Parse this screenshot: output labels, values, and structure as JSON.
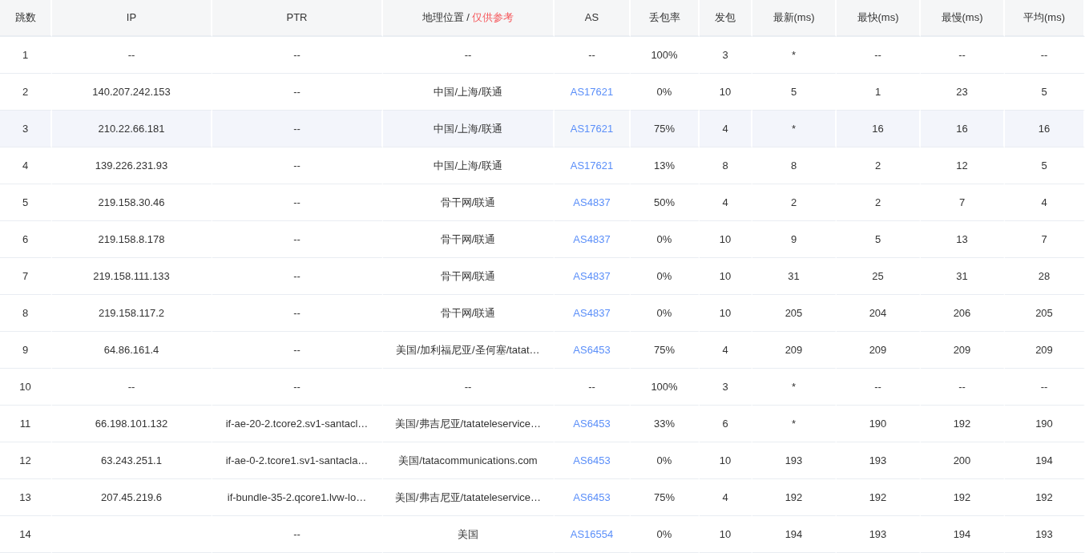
{
  "table": {
    "columns": [
      {
        "label": "跳数"
      },
      {
        "label": "IP"
      },
      {
        "label": "PTR"
      },
      {
        "label": "地理位置 /",
        "note": "仅供参考"
      },
      {
        "label": "AS"
      },
      {
        "label": "丢包率"
      },
      {
        "label": "发包"
      },
      {
        "label": "最新(ms)"
      },
      {
        "label": "最快(ms)"
      },
      {
        "label": "最慢(ms)"
      },
      {
        "label": "平均(ms)"
      }
    ],
    "rows": [
      {
        "highlighted": false,
        "hop": "1",
        "ip": "--",
        "ptr": "--",
        "geo": "--",
        "as": {
          "kind": "plain",
          "text": "--"
        },
        "loss": "100%",
        "sent": "3",
        "last": "*",
        "best": "--",
        "worst": "--",
        "avg": "--"
      },
      {
        "highlighted": false,
        "hop": "2",
        "ip": "140.207.242.153",
        "ptr": "--",
        "geo": "中国/上海/联通",
        "as": {
          "kind": "link",
          "text": "AS17621"
        },
        "loss": "0%",
        "sent": "10",
        "last": "5",
        "best": "1",
        "worst": "23",
        "avg": "5"
      },
      {
        "highlighted": true,
        "hop": "3",
        "ip": "210.22.66.181",
        "ptr": "--",
        "geo": "中国/上海/联通",
        "as": {
          "kind": "link",
          "text": "AS17621"
        },
        "loss": "75%",
        "sent": "4",
        "last": "*",
        "best": "16",
        "worst": "16",
        "avg": "16"
      },
      {
        "highlighted": false,
        "hop": "4",
        "ip": "139.226.231.93",
        "ptr": "--",
        "geo": "中国/上海/联通",
        "as": {
          "kind": "link",
          "text": "AS17621"
        },
        "loss": "13%",
        "sent": "8",
        "last": "8",
        "best": "2",
        "worst": "12",
        "avg": "5"
      },
      {
        "highlighted": false,
        "hop": "5",
        "ip": "219.158.30.46",
        "ptr": "--",
        "geo": "骨干网/联通",
        "as": {
          "kind": "link",
          "text": "AS4837"
        },
        "loss": "50%",
        "sent": "4",
        "last": "2",
        "best": "2",
        "worst": "7",
        "avg": "4"
      },
      {
        "highlighted": false,
        "hop": "6",
        "ip": "219.158.8.178",
        "ptr": "--",
        "geo": "骨干网/联通",
        "as": {
          "kind": "link",
          "text": "AS4837"
        },
        "loss": "0%",
        "sent": "10",
        "last": "9",
        "best": "5",
        "worst": "13",
        "avg": "7"
      },
      {
        "highlighted": false,
        "hop": "7",
        "ip": "219.158.111.133",
        "ptr": "--",
        "geo": "骨干网/联通",
        "as": {
          "kind": "link",
          "text": "AS4837"
        },
        "loss": "0%",
        "sent": "10",
        "last": "31",
        "best": "25",
        "worst": "31",
        "avg": "28"
      },
      {
        "highlighted": false,
        "hop": "8",
        "ip": "219.158.117.2",
        "ptr": "--",
        "geo": "骨干网/联通",
        "as": {
          "kind": "link",
          "text": "AS4837"
        },
        "loss": "0%",
        "sent": "10",
        "last": "205",
        "best": "204",
        "worst": "206",
        "avg": "205"
      },
      {
        "highlighted": false,
        "hop": "9",
        "ip": "64.86.161.4",
        "ptr": "--",
        "geo": "美国/加利福尼亚/圣何塞/tatat…",
        "as": {
          "kind": "link",
          "text": "AS6453"
        },
        "loss": "75%",
        "sent": "4",
        "last": "209",
        "best": "209",
        "worst": "209",
        "avg": "209"
      },
      {
        "highlighted": false,
        "hop": "10",
        "ip": "--",
        "ptr": "--",
        "geo": "--",
        "as": {
          "kind": "plain",
          "text": "--"
        },
        "loss": "100%",
        "sent": "3",
        "last": "*",
        "best": "--",
        "worst": "--",
        "avg": "--"
      },
      {
        "highlighted": false,
        "hop": "11",
        "ip": "66.198.101.132",
        "ptr": "if-ae-20-2.tcore2.sv1-santacl…",
        "geo": "美国/弗吉尼亚/tatateleservice…",
        "as": {
          "kind": "link",
          "text": "AS6453"
        },
        "loss": "33%",
        "sent": "6",
        "last": "*",
        "best": "190",
        "worst": "192",
        "avg": "190"
      },
      {
        "highlighted": false,
        "hop": "12",
        "ip": "63.243.251.1",
        "ptr": "if-ae-0-2.tcore1.sv1-santacla…",
        "geo": "美国/tatacommunications.com",
        "as": {
          "kind": "link",
          "text": "AS6453"
        },
        "loss": "0%",
        "sent": "10",
        "last": "193",
        "best": "193",
        "worst": "200",
        "avg": "194"
      },
      {
        "highlighted": false,
        "hop": "13",
        "ip": "207.45.219.6",
        "ptr": "if-bundle-35-2.qcore1.lvw-lo…",
        "geo": "美国/弗吉尼亚/tatateleservice…",
        "as": {
          "kind": "link",
          "text": "AS6453"
        },
        "loss": "75%",
        "sent": "4",
        "last": "192",
        "best": "192",
        "worst": "192",
        "avg": "192"
      },
      {
        "highlighted": false,
        "hop": "14",
        "ptr": "--",
        "geo": "美国",
        "as": {
          "kind": "link",
          "text": "AS16554"
        },
        "loss": "0%",
        "sent": "10",
        "last": "194",
        "best": "193",
        "worst": "194",
        "avg": "193"
      }
    ]
  }
}
